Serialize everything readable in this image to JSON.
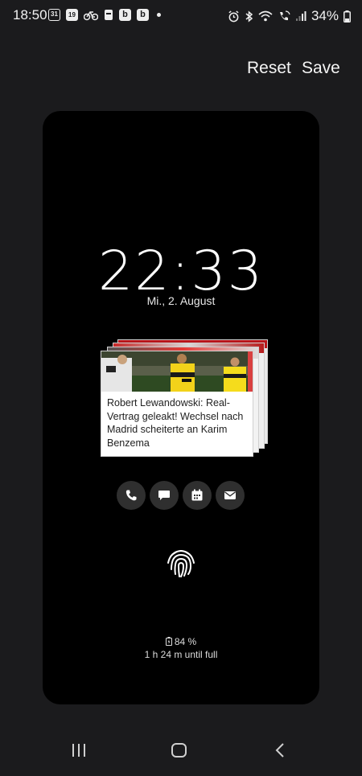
{
  "status_bar": {
    "time": "18:50",
    "icons_left": [
      "calendar-31-icon",
      "calendar-19-icon",
      "bike-icon",
      "cup-icon",
      "b-app-icon",
      "b-app-icon",
      "dot-icon"
    ],
    "calendar_a": "31",
    "calendar_b": "19",
    "b_label": "b",
    "icons_right": [
      "alarm-icon",
      "bluetooth-icon",
      "wifi-icon",
      "wifi-call-icon",
      "signal-icon",
      "battery-icon"
    ],
    "battery": "34%"
  },
  "actions": {
    "reset": "Reset",
    "save": "Save"
  },
  "preview": {
    "clock": "22:33",
    "date": "Mi., 2. August",
    "notification": {
      "text": "Robert Lewandowski: Real-Vertrag geleakt! Wechsel nach Madrid scheiterte an Karim Benzema"
    },
    "shortcuts": [
      "phone-icon",
      "message-icon",
      "calendar-icon",
      "email-icon"
    ],
    "battery_level": "84 %",
    "charging_text": "1 h 24 m until full"
  },
  "navbar": [
    "recents-icon",
    "home-icon",
    "back-icon"
  ],
  "colors": {
    "background": "#1b1b1d",
    "preview": "#000000",
    "shortcut_bg": "#2f2f2f"
  }
}
